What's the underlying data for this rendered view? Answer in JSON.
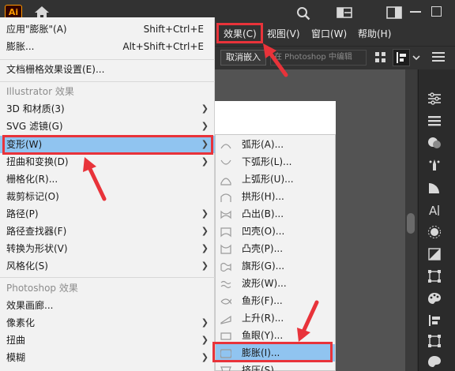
{
  "app": {
    "logo_text": "Ai"
  },
  "menubar": {
    "items": [
      {
        "label": "效果(C)"
      },
      {
        "label": "视图(V)"
      },
      {
        "label": "窗口(W)"
      },
      {
        "label": "帮助(H)"
      }
    ]
  },
  "controlbar": {
    "cancel_embed_label": "取消嵌入",
    "photoshop_edit_label": "在 Photoshop 中编辑"
  },
  "effect_menu": {
    "items": [
      {
        "label": "应用\"膨胀\"(A)",
        "shortcut": "Shift+Ctrl+E"
      },
      {
        "label": "膨胀...",
        "shortcut": "Alt+Shift+Ctrl+E"
      },
      {
        "label": "文档栅格效果设置(E)..."
      },
      {
        "label": "Illustrator 效果"
      },
      {
        "label": "3D 和材质(3)"
      },
      {
        "label": "SVG 滤镜(G)"
      },
      {
        "label": "变形(W)"
      },
      {
        "label": "扭曲和变换(D)"
      },
      {
        "label": "栅格化(R)..."
      },
      {
        "label": "裁剪标记(O)"
      },
      {
        "label": "路径(P)"
      },
      {
        "label": "路径查找器(F)"
      },
      {
        "label": "转换为形状(V)"
      },
      {
        "label": "风格化(S)"
      },
      {
        "label": "Photoshop 效果"
      },
      {
        "label": "效果画廊..."
      },
      {
        "label": "像素化"
      },
      {
        "label": "扭曲"
      },
      {
        "label": "模糊"
      }
    ]
  },
  "warp_submenu": {
    "items": [
      {
        "label": "弧形(A)..."
      },
      {
        "label": "下弧形(L)..."
      },
      {
        "label": "上弧形(U)..."
      },
      {
        "label": "拱形(H)..."
      },
      {
        "label": "凸出(B)..."
      },
      {
        "label": "凹壳(O)..."
      },
      {
        "label": "凸壳(P)..."
      },
      {
        "label": "旗形(G)..."
      },
      {
        "label": "波形(W)..."
      },
      {
        "label": "鱼形(F)..."
      },
      {
        "label": "上升(R)..."
      },
      {
        "label": "鱼眼(Y)..."
      },
      {
        "label": "膨胀(I)..."
      },
      {
        "label": "挤压(S)..."
      }
    ]
  },
  "colors": {
    "highlight": "#90c4f0",
    "annotation_red": "#e8333a",
    "app_dark": "#323232",
    "menu_bg": "#f2f2f2"
  }
}
